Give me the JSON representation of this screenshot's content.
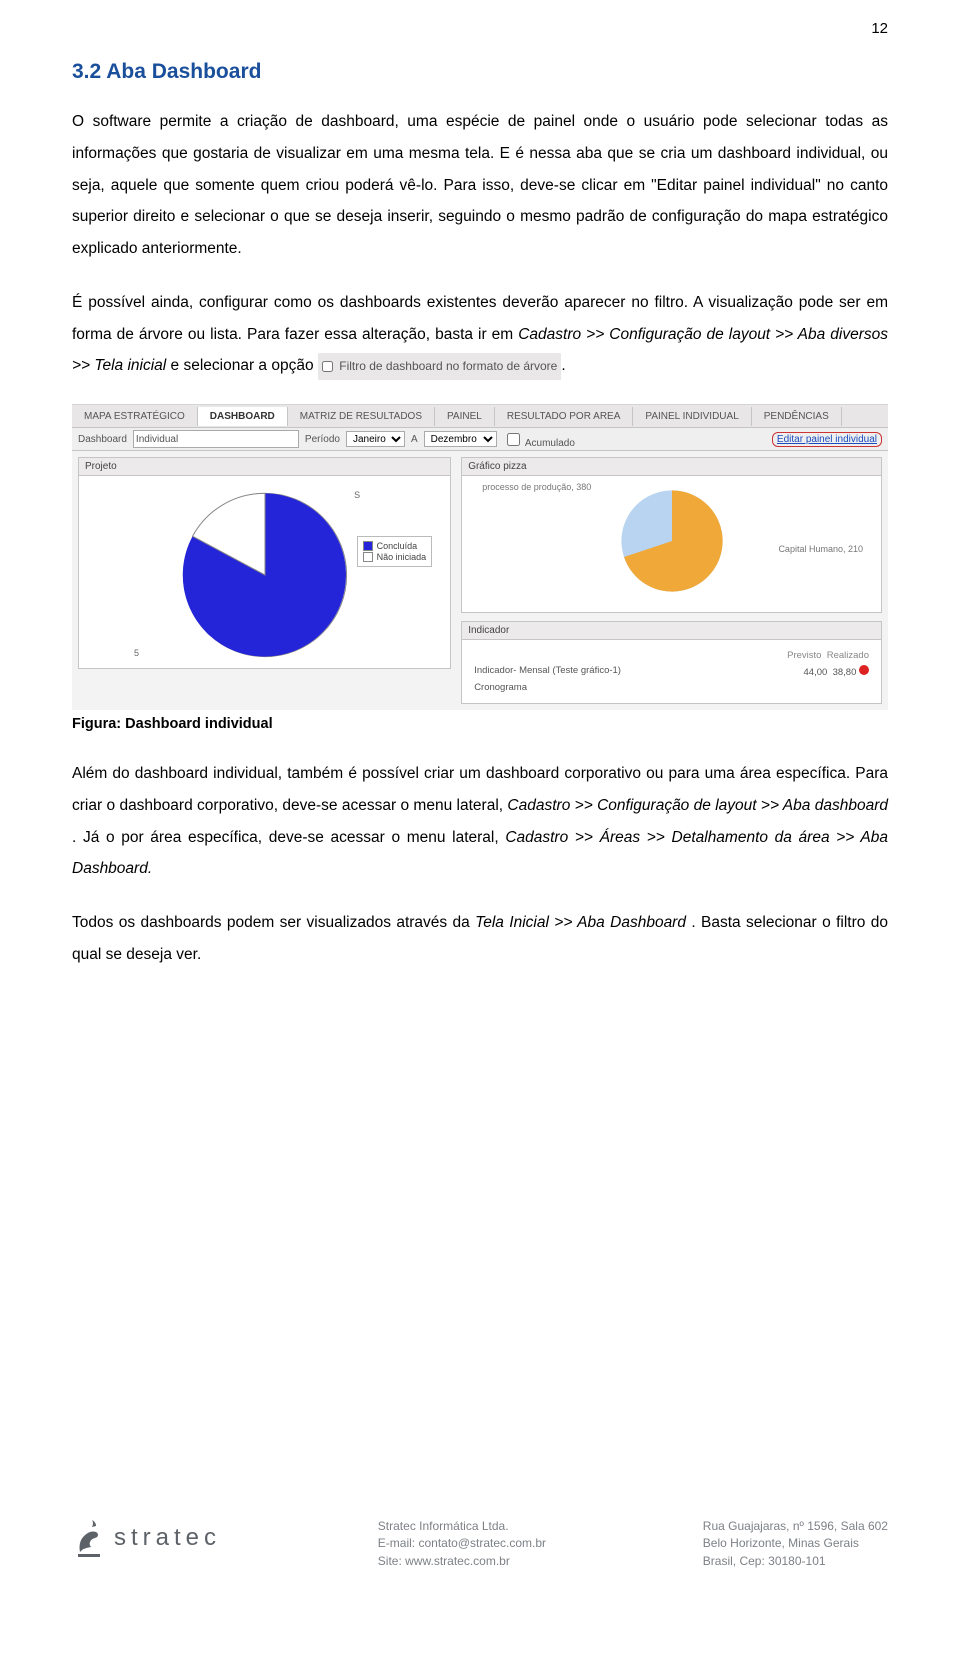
{
  "page_number": "12",
  "heading": "3.2 Aba Dashboard",
  "para1": "O software permite a criação de dashboard, uma espécie de painel onde o usuário pode selecionar todas as informações que gostaria de visualizar em uma mesma tela. E é nessa aba que se cria um dashboard individual, ou seja, aquele que somente quem criou poderá vê-lo. Para isso, deve-se clicar em \"Editar painel individual\" no canto superior direito e selecionar o que se deseja inserir, seguindo o mesmo padrão de configuração do mapa estratégico explicado anteriormente.",
  "para2_a": "É possível ainda, configurar como os dashboards existentes deverão aparecer no filtro. A visualização pode ser em forma de árvore ou lista. Para fazer essa alteração, basta ir em ",
  "para2_path": "Cadastro >> Configuração de layout >> Aba diversos >> Tela inicial",
  "para2_b": " e selecionar a opção ",
  "option_label": "Filtro de dashboard no formato de árvore",
  "screenshot": {
    "tabs": [
      "MAPA ESTRATÉGICO",
      "DASHBOARD",
      "MATRIZ DE RESULTADOS",
      "PAINEL",
      "RESULTADO POR AREA",
      "PAINEL INDIVIDUAL",
      "PENDÊNCIAS"
    ],
    "active_tab": "DASHBOARD",
    "filter": {
      "label_dashboard": "Dashboard",
      "dashboard_value": "Individual",
      "label_periodo": "Período",
      "periodo_from": "Janeiro",
      "label_a": "A",
      "periodo_to": "Dezembro",
      "acumulado": "Acumulado",
      "edit_link": "Editar painel individual"
    },
    "panel_projeto": {
      "title": "Projeto",
      "label_s": "S",
      "label_5": "5",
      "legend_concluida": "Concluída",
      "legend_nao_iniciada": "Não iniciada"
    },
    "panel_pizza": {
      "title": "Gráfico pizza",
      "label_processo": "processo de produção, 380",
      "label_capital": "Capital Humano, 210"
    },
    "panel_indicador": {
      "title": "Indicador",
      "col_previsto": "Previsto",
      "col_realizado": "Realizado",
      "row1_name": "Indicador- Mensal (Teste gráfico-1)",
      "row1_prev": "44,00",
      "row1_real": "38,80",
      "row2_name": "Cronograma"
    }
  },
  "caption": "Figura: Dashboard individual",
  "para3_a": "Além do dashboard individual, também é possível criar um dashboard corporativo ou para uma área específica. Para criar o dashboard corporativo, deve-se acessar o menu lateral, ",
  "para3_path1": "Cadastro >> Configuração de layout >> Aba dashboard",
  "para3_b": ". Já o por área específica, deve-se acessar o menu lateral, ",
  "para3_path2": "Cadastro >> Áreas >> Detalhamento da área >> Aba Dashboard.",
  "para4_a": "Todos os dashboards podem ser visualizados através da ",
  "para4_path": "Tela Inicial >> Aba Dashboard",
  "para4_b": ". Basta selecionar o filtro do qual se deseja ver.",
  "footer": {
    "brand": "stratec",
    "col1_l1": "Stratec Informática Ltda.",
    "col1_l2": "E-mail: contato@stratec.com.br",
    "col1_l3": "Site: www.stratec.com.br",
    "col2_l1": "Rua Guajajaras, nº 1596, Sala 602",
    "col2_l2": "Belo Horizonte, Minas Gerais",
    "col2_l3": "Brasil, Cep: 30180-101"
  },
  "chart_data": [
    {
      "type": "pie",
      "title": "Projeto",
      "series": [
        {
          "name": "Concluída",
          "value": 5,
          "color": "#2424d8"
        },
        {
          "name": "Não iniciada",
          "value": 1,
          "color": "#ffffff"
        }
      ]
    },
    {
      "type": "pie",
      "title": "Gráfico pizza",
      "series": [
        {
          "name": "processo de produção",
          "value": 380,
          "color": "#f0a838"
        },
        {
          "name": "Capital Humano",
          "value": 210,
          "color": "#b8d4f0"
        }
      ]
    }
  ]
}
